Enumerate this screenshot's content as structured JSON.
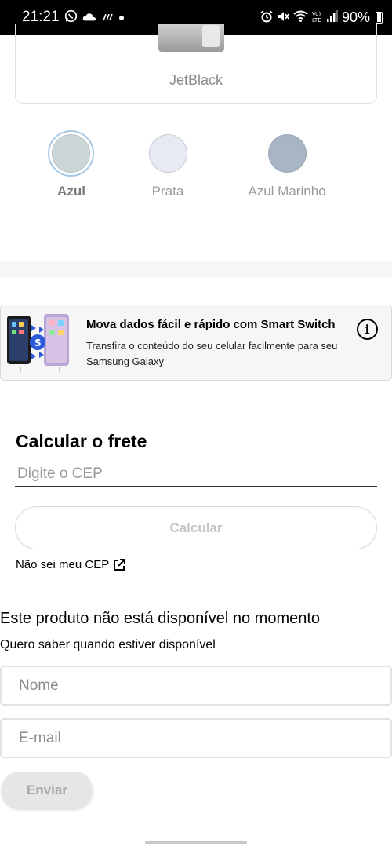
{
  "status_bar": {
    "time": "21:21",
    "battery": "90%",
    "icons": [
      "whatsapp-icon",
      "cloud-icon",
      "rain-icon",
      "dot-icon",
      "alarm-icon",
      "mute-icon",
      "wifi-icon",
      "volte-icon",
      "signal-icon",
      "battery-icon"
    ]
  },
  "product_card": {
    "name": "JetBlack"
  },
  "colors": {
    "options": [
      {
        "label": "Azul",
        "swatch": "#cad5d6",
        "selected": true
      },
      {
        "label": "Prata",
        "swatch": "#e7eaf3",
        "selected": false
      },
      {
        "label": "Azul Marinho",
        "swatch": "#a8b5c4",
        "selected": false
      }
    ],
    "selected_label_color": "#7a7a7a",
    "unselected_label_color": "#9a9a9a"
  },
  "smart_switch": {
    "title": "Mova dados fácil e rápido com Smart Switch",
    "description": "Transfira o conteúdo do seu celular facilmente para seu Samsung Galaxy",
    "info_icon": "info-icon"
  },
  "shipping": {
    "title": "Calcular o frete",
    "cep_placeholder": "Digite o CEP",
    "calculate_label": "Calcular",
    "unknown_cep_link": "Não sei meu CEP"
  },
  "unavailable": {
    "title": "Este produto não está disponível no momento",
    "subtitle": "Quero saber quando estiver disponível",
    "name_placeholder": "Nome",
    "email_placeholder": "E-mail",
    "send_label": "Enviar"
  }
}
